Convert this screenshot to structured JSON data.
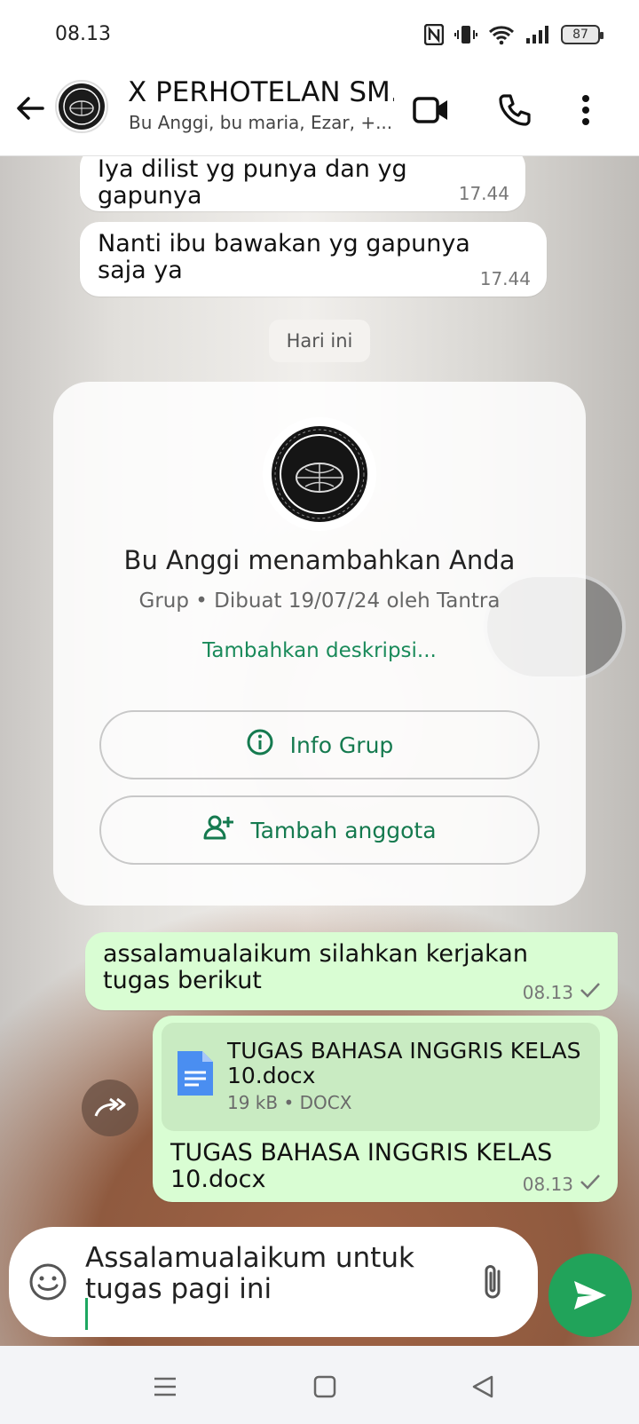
{
  "status_bar": {
    "time": "08.13",
    "battery": "87",
    "icons": [
      "nfc-icon",
      "vibrate-icon",
      "wifi-icon",
      "signal-icon",
      "battery-icon"
    ]
  },
  "header": {
    "title": "X PERHOTELAN SM...",
    "subtitle": "Bu Anggi, bu maria, Ezar, +...",
    "icons": [
      "back-arrow-icon",
      "group-avatar",
      "video-call-icon",
      "phone-call-icon",
      "more-options-icon"
    ]
  },
  "messages": {
    "m1": {
      "text": "Iya dilist yg punya dan yg gapunya",
      "time": "17.44"
    },
    "m2": {
      "text": "Nanti ibu bawakan yg gapunya saja ya",
      "time": "17.44"
    },
    "date_chip": "Hari ini",
    "system_card": {
      "title": "Bu Anggi menambahkan Anda",
      "meta": "Grup • Dibuat 19/07/24 oleh Tantra",
      "description_link": "Tambahkan deskripsi...",
      "info_button": "Info Grup",
      "add_member_button": "Tambah anggota"
    },
    "m3": {
      "text": "assalamualaikum silahkan kerjakan tugas berikut",
      "time": "08.13"
    },
    "m4": {
      "doc_name": "TUGAS BAHASA INGGRIS KELAS 10.docx",
      "doc_meta": "19 kB • DOCX",
      "caption": "TUGAS BAHASA INGGRIS KELAS 10.docx",
      "time": "08.13"
    }
  },
  "composer": {
    "text": "Assalamualaikum untuk tugas pagi ini"
  },
  "colors": {
    "accent_green": "#21a35a",
    "outgoing_bubble": "#d9fdd3",
    "incoming_bubble": "#ffffff",
    "link_green": "#1a8a5a"
  }
}
